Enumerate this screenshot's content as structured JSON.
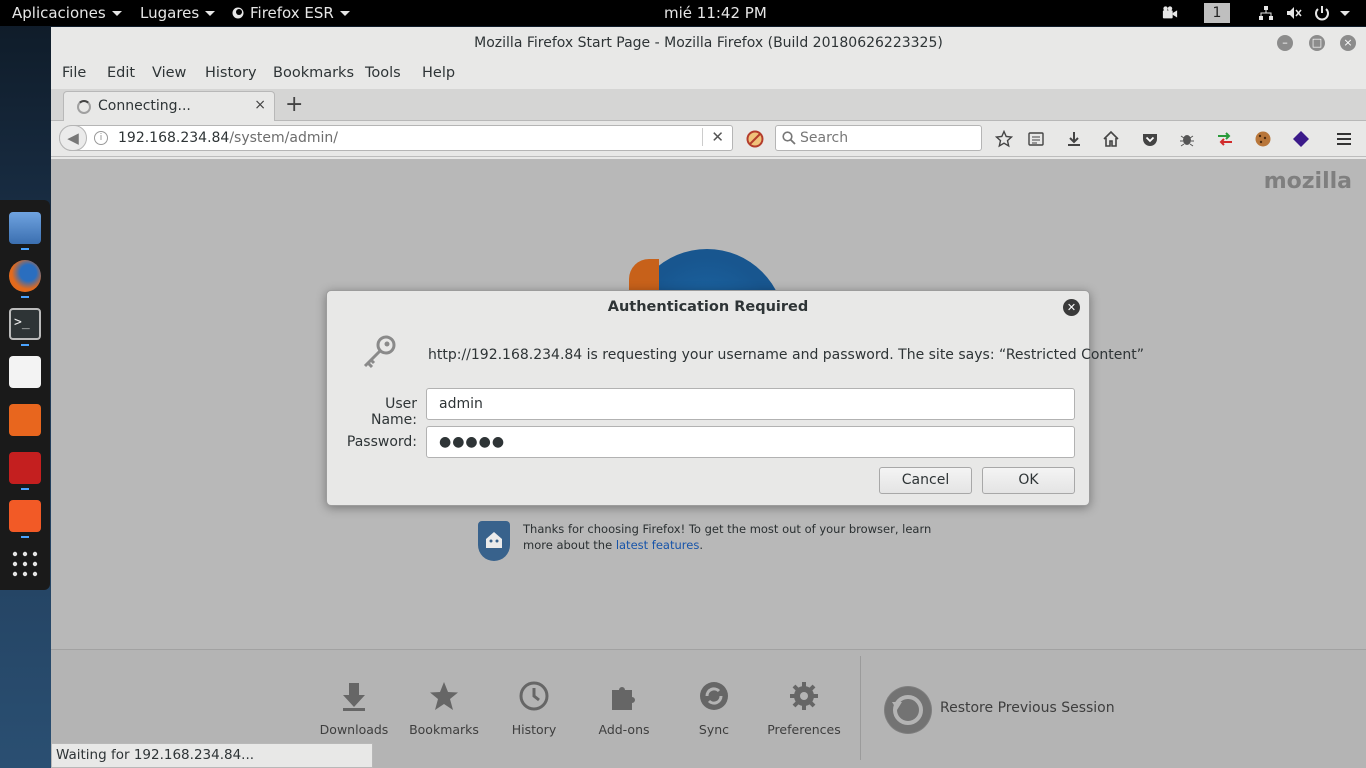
{
  "top_panel": {
    "apps_label": "Aplicaciones",
    "places_label": "Lugares",
    "active_app": "Firefox ESR",
    "clock": "mié 11:42 PM",
    "workspace": "1"
  },
  "window": {
    "title": "Mozilla Firefox Start Page - Mozilla Firefox (Build 20180626223325)"
  },
  "menubar": {
    "items": [
      "File",
      "Edit",
      "View",
      "History",
      "Bookmarks",
      "Tools",
      "Help"
    ]
  },
  "tab": {
    "label": "Connecting...",
    "close": "×",
    "new_tab": "+"
  },
  "navbar": {
    "url_host": "192.168.234.84",
    "url_path": "/system/admin/",
    "search_placeholder": "Search"
  },
  "page": {
    "logo": "mozilla",
    "snippet_text": "Thanks for choosing Firefox! To get the most out of your browser, learn more about the ",
    "snippet_link": "latest features",
    "snippet_end": ".",
    "launchers": [
      "Downloads",
      "Bookmarks",
      "History",
      "Add-ons",
      "Sync",
      "Preferences"
    ],
    "restore_label": "Restore Previous Session",
    "status": "Waiting for 192.168.234.84..."
  },
  "dialog": {
    "title": "Authentication Required",
    "message": "http://192.168.234.84 is requesting your username and password. The site says: “Restricted Content”",
    "username_label": "User Name:",
    "username_value": "admin",
    "password_label": "Password:",
    "password_value": "●●●●●",
    "cancel_label": "Cancel",
    "ok_label": "OK"
  }
}
